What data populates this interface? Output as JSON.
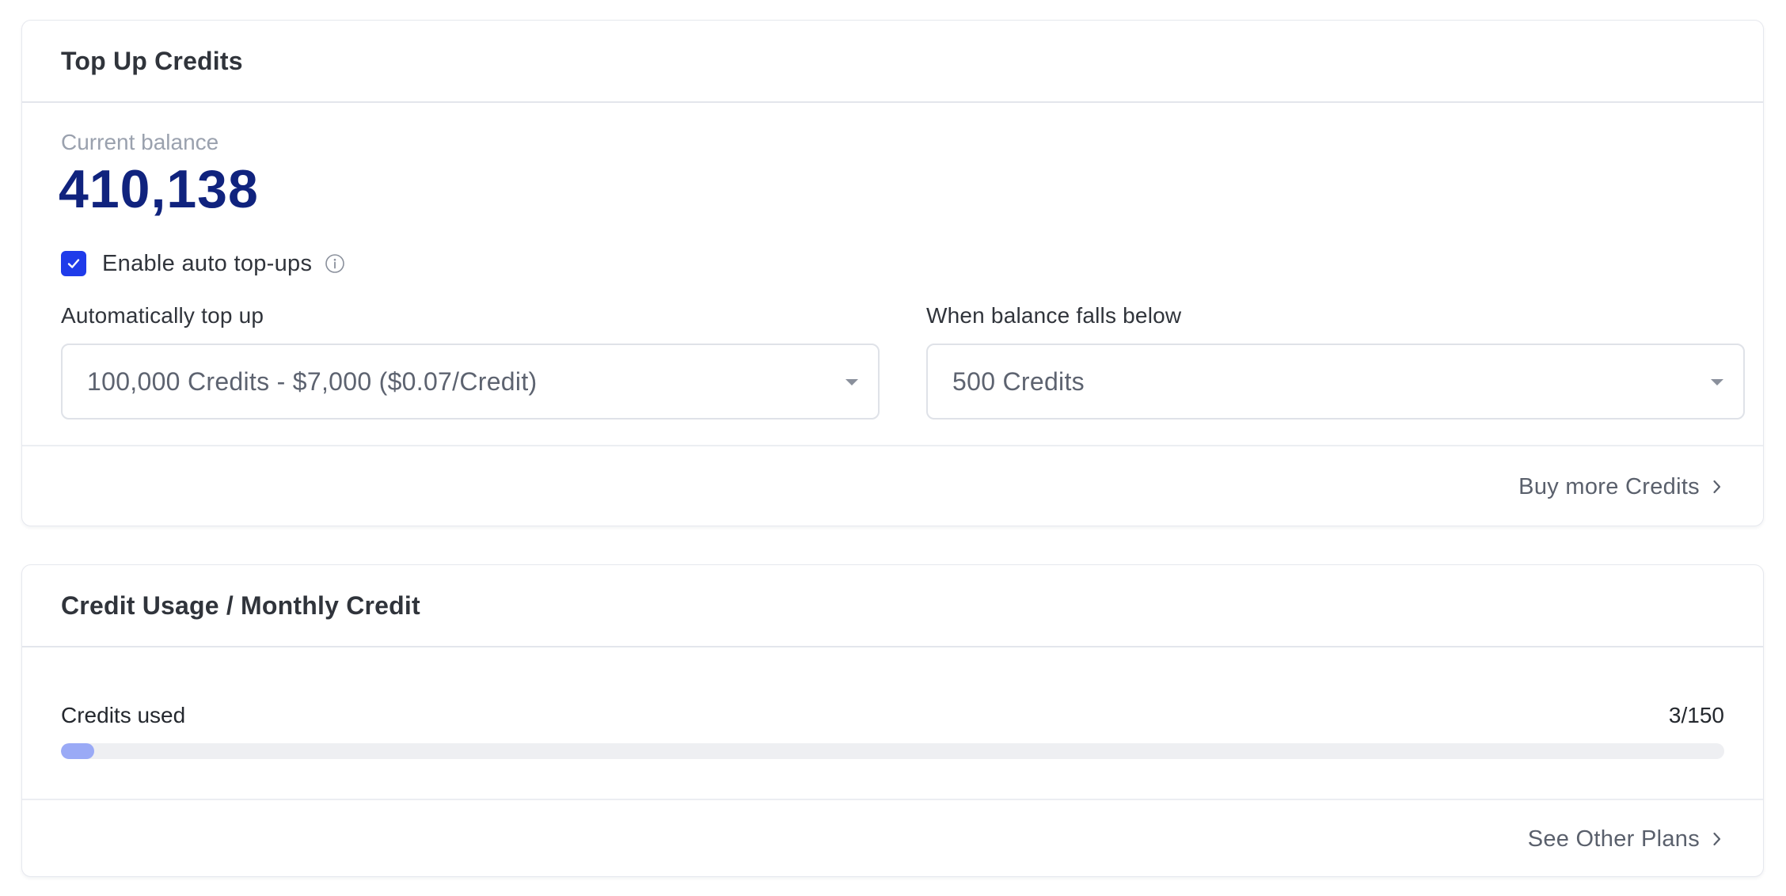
{
  "topup_card": {
    "title": "Top Up Credits",
    "balance_label": "Current balance",
    "balance_value": "410,138",
    "auto_topup_label": "Enable auto top-ups",
    "auto_topup_enabled": true,
    "auto_topup_field_label": "Automatically top up",
    "auto_topup_selected": "100,000 Credits - $7,000 ($0.07/Credit)",
    "threshold_field_label": "When balance falls below",
    "threshold_selected": "500 Credits",
    "buy_more_link": "Buy more Credits",
    "accent_color": "#1f3bea",
    "balance_color": "#10237e"
  },
  "usage_card": {
    "title": "Credit Usage / Monthly Credit",
    "credits_used_label": "Credits used",
    "credits_used_count": "3/150",
    "credits_used_fraction": 0.02,
    "see_plans_link": "See Other Plans",
    "progress_color": "#9aaaf6"
  },
  "icons": {
    "checkbox": "check-icon",
    "info": "info-icon",
    "caret": "caret-down-icon",
    "chevron": "chevron-right-icon"
  }
}
